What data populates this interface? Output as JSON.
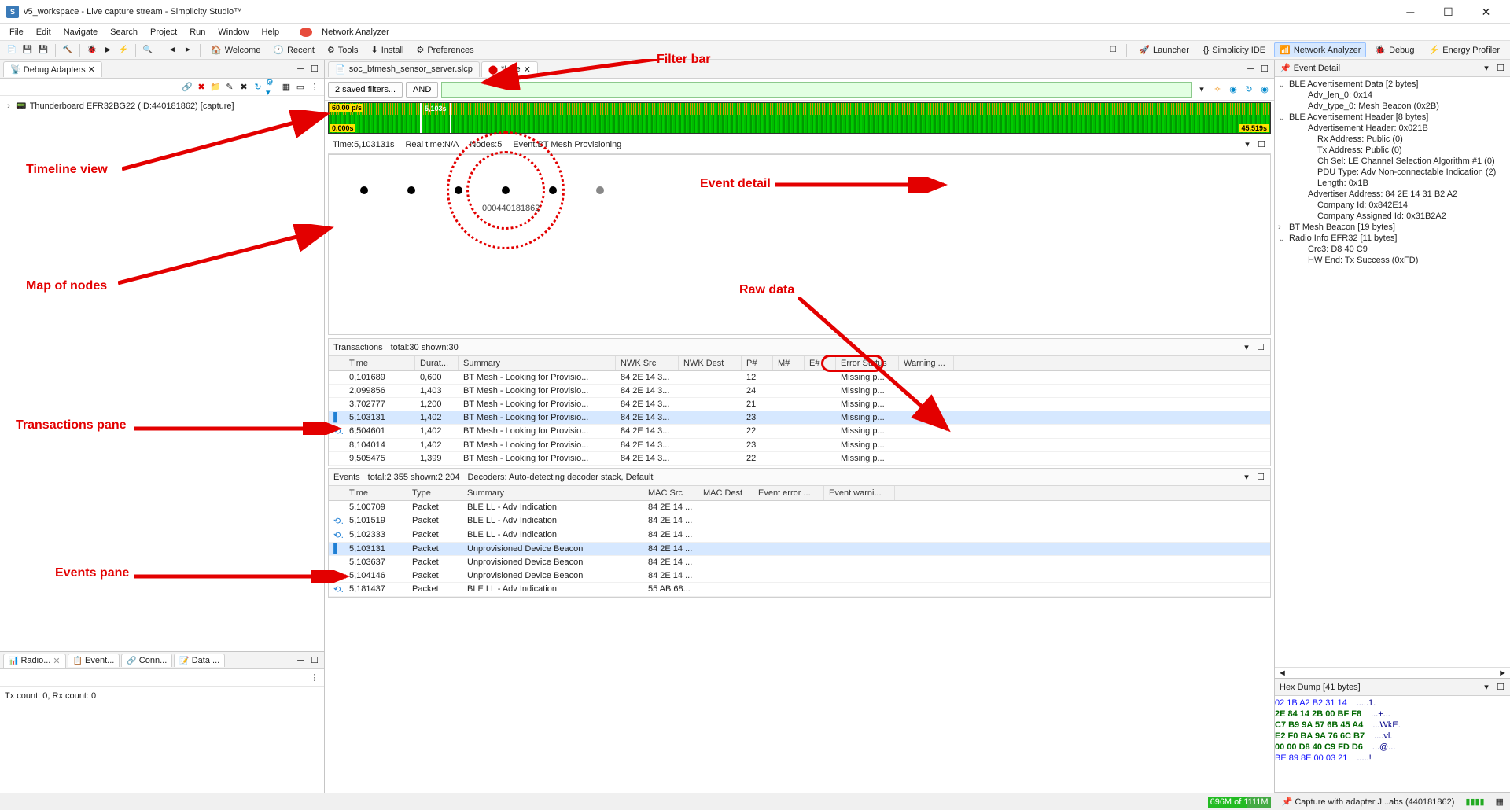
{
  "title": "v5_workspace - Live capture stream - Simplicity Studio™",
  "win": {
    "min": "─",
    "max": "☐",
    "close": "✕"
  },
  "menu": [
    "File",
    "Edit",
    "Navigate",
    "Search",
    "Project",
    "Run",
    "Window",
    "Help"
  ],
  "na_anchor": "Network Analyzer",
  "toolbar": {
    "welcome": "Welcome",
    "recent": "Recent",
    "tools": "Tools",
    "install": "Install",
    "prefs": "Preferences"
  },
  "persp": {
    "launcher": "Launcher",
    "simp": "Simplicity IDE",
    "na": "Network Analyzer",
    "dbg": "Debug",
    "ep": "Energy Profiler"
  },
  "debug_adapters": {
    "title": "Debug Adapters",
    "node": "Thunderboard EFR32BG22 (ID:440181862) [capture]"
  },
  "bottom_tabs": {
    "radio": "Radio...",
    "event": "Event...",
    "conn": "Conn...",
    "data": "Data ..."
  },
  "radio_info": "Tx count: 0, Rx count: 0",
  "editor_tabs": {
    "slcp": "soc_btmesh_sensor_server.slcp",
    "live": "*Live"
  },
  "filter": {
    "saved": "2 saved filters...",
    "op": "AND",
    "value": ""
  },
  "timeline": {
    "rate": "60.00 p/s",
    "start": "0.000s",
    "cursor": "5,103s",
    "end": "45.519s"
  },
  "info_row": {
    "time": "Time:5,103131s",
    "rt": "Real time:N/A",
    "nodes": "Nodes:5",
    "event": "Event:BT Mesh Provisioning"
  },
  "map": {
    "label": "000440181862"
  },
  "transactions": {
    "header": "Transactions",
    "totals": "total:30 shown:30",
    "cols": {
      "time": "Time",
      "dur": "Durat...",
      "sum": "Summary",
      "nws": "NWK Src",
      "nwd": "NWK Dest",
      "p": "P#",
      "m": "M#",
      "e": "E#",
      "err": "Error Status",
      "wrn": "Warning ..."
    },
    "rows": [
      {
        "lead": "",
        "time": "0,101689",
        "dur": "0,600",
        "sum": "BT Mesh - Looking for Provisio...",
        "nws": "84 2E 14 3...",
        "nwd": "",
        "p": "12",
        "m": "",
        "e": "",
        "err": "Missing p...",
        "wrn": ""
      },
      {
        "lead": "",
        "time": "2,099856",
        "dur": "1,403",
        "sum": "BT Mesh - Looking for Provisio...",
        "nws": "84 2E 14 3...",
        "nwd": "",
        "p": "24",
        "m": "",
        "e": "",
        "err": "Missing p...",
        "wrn": ""
      },
      {
        "lead": "",
        "time": "3,702777",
        "dur": "1,200",
        "sum": "BT Mesh - Looking for Provisio...",
        "nws": "84 2E 14 3...",
        "nwd": "",
        "p": "21",
        "m": "",
        "e": "",
        "err": "Missing p...",
        "wrn": ""
      },
      {
        "lead": "▌",
        "sel": true,
        "time": "5,103131",
        "dur": "1,402",
        "sum": "BT Mesh - Looking for Provisio...",
        "nws": "84 2E 14 3...",
        "nwd": "",
        "p": "23",
        "m": "",
        "e": "",
        "err": "Missing p...",
        "wrn": ""
      },
      {
        "lead": "⟲",
        "time": "6,504601",
        "dur": "1,402",
        "sum": "BT Mesh - Looking for Provisio...",
        "nws": "84 2E 14 3...",
        "nwd": "",
        "p": "22",
        "m": "",
        "e": "",
        "err": "Missing p...",
        "wrn": ""
      },
      {
        "lead": "",
        "time": "8,104014",
        "dur": "1,402",
        "sum": "BT Mesh - Looking for Provisio...",
        "nws": "84 2E 14 3...",
        "nwd": "",
        "p": "23",
        "m": "",
        "e": "",
        "err": "Missing p...",
        "wrn": ""
      },
      {
        "lead": "",
        "time": "9,505475",
        "dur": "1,399",
        "sum": "BT Mesh - Looking for Provisio...",
        "nws": "84 2E 14 3...",
        "nwd": "",
        "p": "22",
        "m": "",
        "e": "",
        "err": "Missing p...",
        "wrn": ""
      }
    ]
  },
  "events": {
    "header": "Events",
    "totals": "total:2 355 shown:2 204",
    "decoder": "Decoders: Auto-detecting decoder stack, Default",
    "cols": {
      "time": "Time",
      "type": "Type",
      "sum": "Summary",
      "msrc": "MAC Src",
      "mdst": "MAC Dest",
      "err": "Event error ...",
      "wrn": "Event warni..."
    },
    "rows": [
      {
        "lead": "",
        "time": "5,100709",
        "type": "Packet",
        "sum": "BLE LL - Adv Indication",
        "msrc": "84 2E 14 ...",
        "mdst": "",
        "err": "",
        "wrn": ""
      },
      {
        "lead": "⟲",
        "time": "5,101519",
        "type": "Packet",
        "sum": "BLE LL - Adv Indication",
        "msrc": "84 2E 14 ...",
        "mdst": "",
        "err": "",
        "wrn": ""
      },
      {
        "lead": "⟲",
        "time": "5,102333",
        "type": "Packet",
        "sum": "BLE LL - Adv Indication",
        "msrc": "84 2E 14 ...",
        "mdst": "",
        "err": "",
        "wrn": ""
      },
      {
        "lead": "▌",
        "sel": true,
        "time": "5,103131",
        "type": "Packet",
        "sum": "Unprovisioned Device Beacon",
        "msrc": "84 2E 14 ...",
        "mdst": "",
        "err": "",
        "wrn": ""
      },
      {
        "lead": "",
        "time": "5,103637",
        "type": "Packet",
        "sum": "Unprovisioned Device Beacon",
        "msrc": "84 2E 14 ...",
        "mdst": "",
        "err": "",
        "wrn": ""
      },
      {
        "lead": "",
        "time": "5,104146",
        "type": "Packet",
        "sum": "Unprovisioned Device Beacon",
        "msrc": "84 2E 14 ...",
        "mdst": "",
        "err": "",
        "wrn": ""
      },
      {
        "lead": "⟲",
        "time": "5,181437",
        "type": "Packet",
        "sum": "BLE LL - Adv Indication",
        "msrc": "55 AB 68...",
        "mdst": "",
        "err": "",
        "wrn": ""
      }
    ]
  },
  "event_detail": {
    "header": "Event Detail",
    "items": [
      {
        "t": "v",
        "d": 0,
        "l": "BLE Advertisement Data [2 bytes]"
      },
      {
        "d": 2,
        "l": "Adv_len_0: 0x14"
      },
      {
        "d": 2,
        "l": "Adv_type_0: Mesh Beacon (0x2B)"
      },
      {
        "t": "v",
        "d": 0,
        "l": "BLE Advertisement Header [8 bytes]"
      },
      {
        "d": 2,
        "l": "Advertisement Header: 0x021B"
      },
      {
        "d": 3,
        "l": "Rx Address: Public (0)"
      },
      {
        "d": 3,
        "l": "Tx Address: Public (0)"
      },
      {
        "d": 3,
        "l": "Ch Sel: LE Channel Selection Algorithm #1 (0)"
      },
      {
        "d": 3,
        "l": "PDU Type: Adv Non-connectable Indication (2)"
      },
      {
        "d": 3,
        "l": "Length: 0x1B"
      },
      {
        "d": 2,
        "l": "Advertiser Address: 84 2E 14 31 B2 A2"
      },
      {
        "d": 3,
        "l": "Company Id: 0x842E14"
      },
      {
        "d": 3,
        "l": "Company Assigned Id: 0x31B2A2"
      },
      {
        "t": ">",
        "d": 0,
        "l": "BT Mesh Beacon [19 bytes]"
      },
      {
        "t": "v",
        "d": 0,
        "l": "Radio Info EFR32 [11 bytes]"
      },
      {
        "d": 2,
        "l": "Crc3: D8 40 C9"
      },
      {
        "d": 2,
        "l": "HW End: Tx Success (0xFD)"
      }
    ]
  },
  "hex": {
    "header": "Hex Dump [41 bytes]",
    "lines": [
      {
        "hex": "02 1B A2 B2 31 14",
        "asc": ".....1."
      },
      {
        "hex": "2E 84 14 2B 00 BF F8",
        "asc": "...+..."
      },
      {
        "hex": "C7 B9 9A 57 6B 45 A4",
        "asc": "...WkE."
      },
      {
        "hex": "E2 F0 BA 9A 76 6C B7",
        "asc": "....vl."
      },
      {
        "hex": "00 00 D8 40 C9 FD D6",
        "asc": "...@..."
      },
      {
        "hex": "BE 89 8E 00 03 21",
        "asc": ".....!"
      }
    ]
  },
  "status": {
    "mem": "696M of 1111M",
    "cap": "Capture with adapter J...abs (440181862)"
  },
  "anno": {
    "filter": "Filter bar",
    "timeline": "Timeline view",
    "map": "Map of nodes",
    "eventd": "Event detail",
    "raw": "Raw data",
    "trans": "Transactions pane",
    "events": "Events pane"
  }
}
